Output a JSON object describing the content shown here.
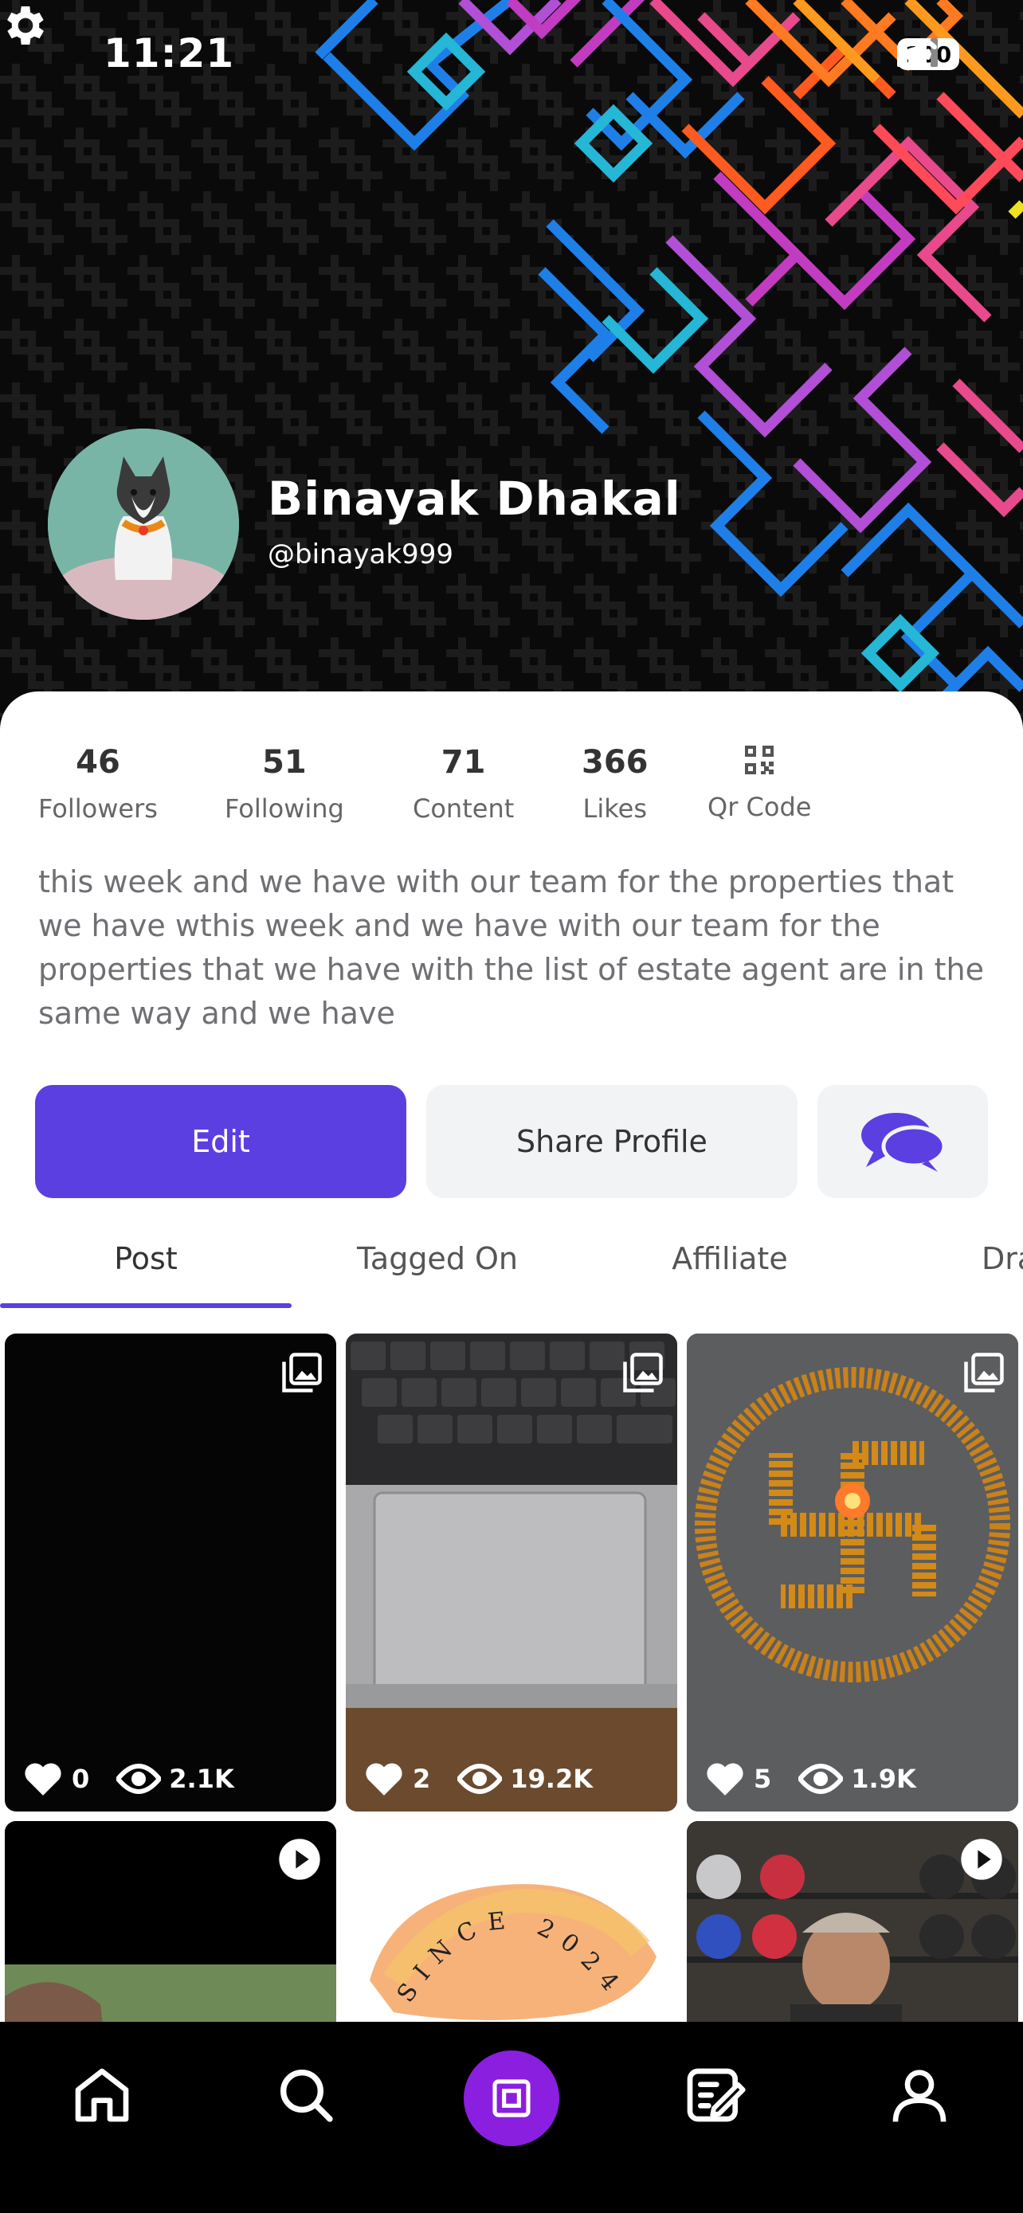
{
  "status_bar": {
    "time": "11:21",
    "battery": "100"
  },
  "profile": {
    "name": "Binayak Dhakal",
    "handle": "@binayak999"
  },
  "stats": [
    {
      "value": "46",
      "label": "Followers"
    },
    {
      "value": "51",
      "label": "Following"
    },
    {
      "value": "71",
      "label": "Content"
    },
    {
      "value": "366",
      "label": "Likes"
    },
    {
      "label": "Qr Code",
      "icon": "qr-code-icon"
    }
  ],
  "bio": "this week and we have with our team for the properties that we have wthis week and we have with our team for the properties that we have with the list of estate agent are in the same way and we have",
  "actions": {
    "edit": "Edit",
    "share": "Share Profile",
    "chat_icon": "chat-bubbles-icon"
  },
  "tabs": [
    "Post",
    "Tagged On",
    "Affiliate",
    "Dra"
  ],
  "active_tab": "Post",
  "posts": [
    {
      "likes": "0",
      "views": "2.1K",
      "type": "image"
    },
    {
      "likes": "2",
      "views": "19.2K",
      "type": "image"
    },
    {
      "likes": "5",
      "views": "1.9K",
      "type": "image"
    },
    {
      "type": "video"
    },
    {
      "type": "image",
      "overlay_text": "SINCE 2024"
    },
    {
      "type": "video"
    }
  ],
  "bottom_nav": [
    "home-icon",
    "search-icon",
    "create-icon",
    "edit-icon",
    "profile-icon"
  ],
  "colors": {
    "accent": "#5b3fe0",
    "create_button": "#8a1fe0"
  }
}
